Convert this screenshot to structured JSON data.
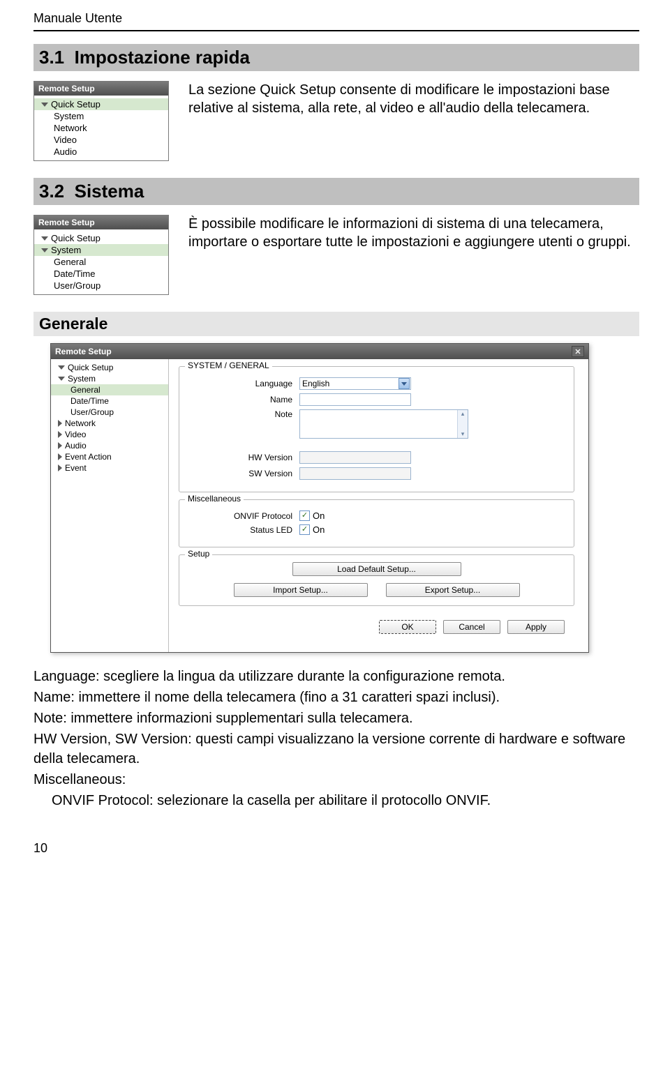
{
  "doc": {
    "header": "Manuale Utente",
    "page_number": "10"
  },
  "sections": {
    "s1": {
      "number": "3.1",
      "title": "Impostazione rapida",
      "para": "La sezione Quick Setup consente di modificare le impostazioni base relative al sistema, alla rete, al video e all'audio della telecamera."
    },
    "s2": {
      "number": "3.2",
      "title": "Sistema",
      "para": "È possibile modificare le informazioni di sistema di una telecamera, importare o esportare tutte le impostazioni e aggiungere utenti o gruppi."
    },
    "sub1": {
      "title": "Generale"
    }
  },
  "panelA": {
    "title": "Remote Setup",
    "items": [
      "Quick Setup",
      "System",
      "Network",
      "Video",
      "Audio"
    ]
  },
  "panelB": {
    "title": "Remote Setup",
    "top": [
      "Quick Setup",
      "System"
    ],
    "sub": [
      "General",
      "Date/Time",
      "User/Group"
    ]
  },
  "dialog": {
    "title": "Remote Setup",
    "sidebar": {
      "open": [
        "Quick Setup",
        "System"
      ],
      "system_children": [
        "General",
        "Date/Time",
        "User/Group"
      ],
      "closed": [
        "Network",
        "Video",
        "Audio",
        "Event Action",
        "Event"
      ]
    },
    "group_general": {
      "legend": "SYSTEM / GENERAL",
      "language_label": "Language",
      "language_value": "English",
      "name_label": "Name",
      "note_label": "Note",
      "hw_label": "HW Version",
      "sw_label": "SW Version"
    },
    "group_misc": {
      "legend": "Miscellaneous",
      "onvif_label": "ONVIF Protocol",
      "onvif_value": "On",
      "led_label": "Status LED",
      "led_value": "On"
    },
    "group_setup": {
      "legend": "Setup",
      "load": "Load Default Setup...",
      "import": "Import Setup...",
      "export": "Export Setup..."
    },
    "footer": {
      "ok": "OK",
      "cancel": "Cancel",
      "apply": "Apply"
    }
  },
  "bullets": {
    "b1": "Language: scegliere la lingua da utilizzare durante la configurazione remota.",
    "b2": "Name: immettere il nome della telecamera (fino a 31 caratteri spazi inclusi).",
    "b3": "Note: immettere informazioni supplementari sulla telecamera.",
    "b4": "HW Version, SW Version: questi campi visualizzano la versione corrente di hardware e software della telecamera.",
    "b5": "Miscellaneous:",
    "b5a": "ONVIF Protocol: selezionare la casella per abilitare il protocollo ONVIF."
  }
}
